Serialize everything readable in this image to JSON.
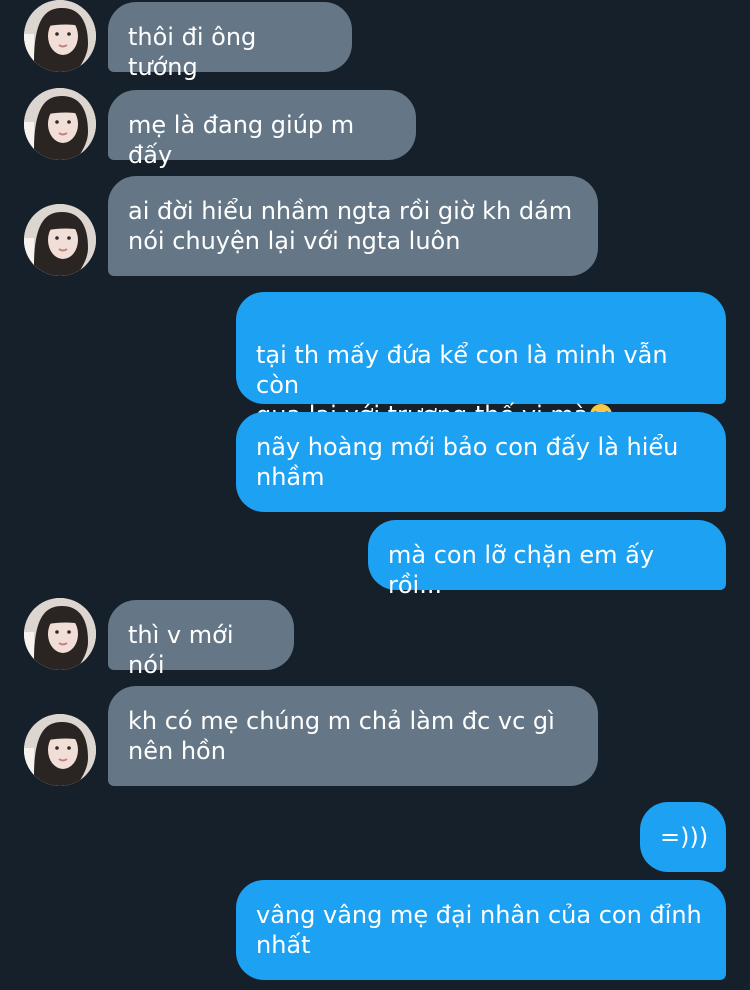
{
  "messages": [
    {
      "sender": "incoming",
      "text": "thôi đi ông tướng"
    },
    {
      "sender": "incoming",
      "text": "mẹ là đang giúp m đấy"
    },
    {
      "sender": "incoming",
      "text": "ai đời hiểu nhầm ngta rồi giờ kh dám\nnói chuyện lại với ngta luôn"
    },
    {
      "sender": "outgoing",
      "text": "tại th mấy đứa kể con là minh vẫn còn\nqua lại với trương thế vi mà",
      "emoji": "disappointed-face-emoji"
    },
    {
      "sender": "outgoing",
      "text": "nãy hoàng mới bảo con đấy là hiểu\nnhầm"
    },
    {
      "sender": "outgoing",
      "text": "mà con lỡ chặn em ấy rồi..."
    },
    {
      "sender": "incoming",
      "text": "thì v mới nói"
    },
    {
      "sender": "incoming",
      "text": "kh có mẹ chúng m chả làm đc vc gì\nnên hồn"
    },
    {
      "sender": "outgoing",
      "text": "=)))"
    },
    {
      "sender": "outgoing",
      "text": "vâng vâng mẹ đại nhân của con đỉnh\nnhất"
    }
  ],
  "theme": {
    "background": "#15202b",
    "incoming_bubble": "#657786",
    "outgoing_bubble": "#1da1f2",
    "text": "#ffffff"
  }
}
